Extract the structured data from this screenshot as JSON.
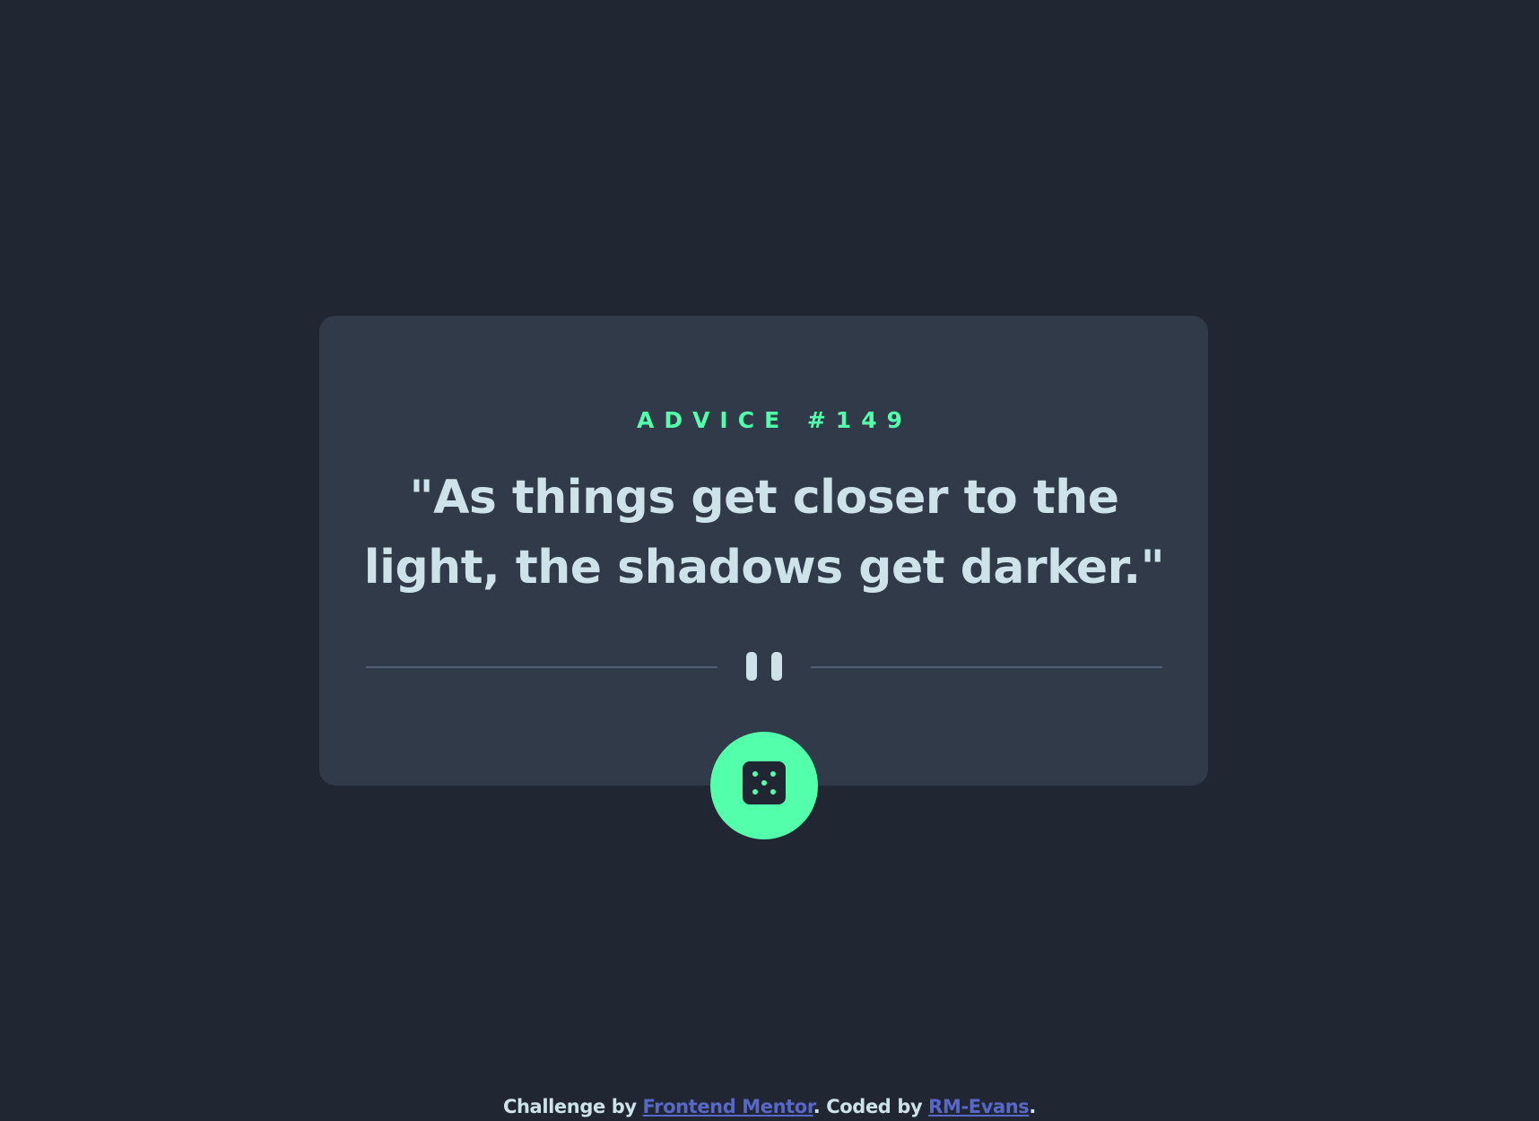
{
  "card": {
    "advice_label": "ADVICE #149",
    "quote": "\"As things get closer to the light, the shadows get darker.\""
  },
  "divider": {
    "icon": "pause-icon"
  },
  "button": {
    "icon": "dice-icon"
  },
  "footer": {
    "prefix": "Challenge by ",
    "link1": "Frontend Mentor",
    "middle": ". Coded by ",
    "link2": "RM-Evans",
    "suffix": "."
  },
  "colors": {
    "background": "#202733",
    "card": "#313A48",
    "accent": "#53FFAA",
    "text": "#CEE3E9",
    "divider": "#4F5D74",
    "link": "#5967C9"
  }
}
